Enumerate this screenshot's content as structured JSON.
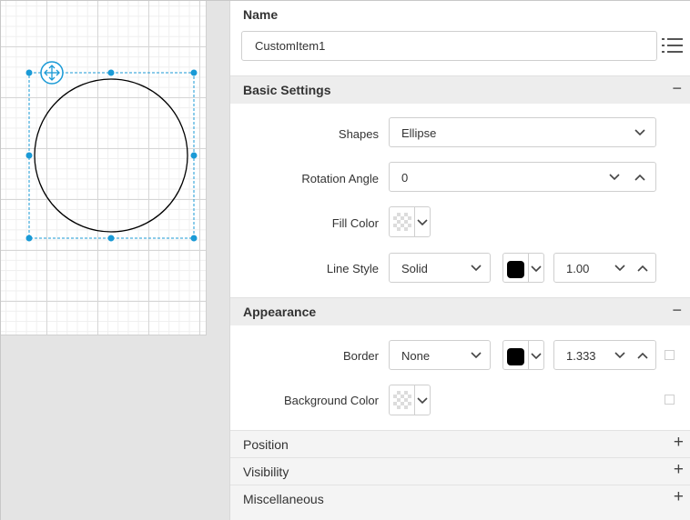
{
  "name_section": {
    "label": "Name",
    "value": "CustomItem1"
  },
  "basic_settings": {
    "title": "Basic Settings",
    "toggle": "−",
    "shapes_label": "Shapes",
    "shapes_value": "Ellipse",
    "rotation_label": "Rotation Angle",
    "rotation_value": "0",
    "fill_label": "Fill Color",
    "line_style_label": "Line Style",
    "line_style_value": "Solid",
    "line_color": "#000000",
    "line_width": "1.00"
  },
  "appearance": {
    "title": "Appearance",
    "toggle": "−",
    "border_label": "Border",
    "border_value": "None",
    "border_color": "#000000",
    "border_width": "1.333",
    "background_label": "Background Color"
  },
  "collapsed_sections": [
    {
      "title": "Position",
      "toggle": "+"
    },
    {
      "title": "Visibility",
      "toggle": "+"
    },
    {
      "title": "Miscellaneous",
      "toggle": "+"
    }
  ],
  "colors": {
    "selection_handle": "#1a9ad6",
    "ellipse_stroke": "#000000"
  },
  "icons": [
    "move-icon",
    "list-icon",
    "chevron-down-icon",
    "chevron-up-icon",
    "minus-icon",
    "plus-icon"
  ]
}
